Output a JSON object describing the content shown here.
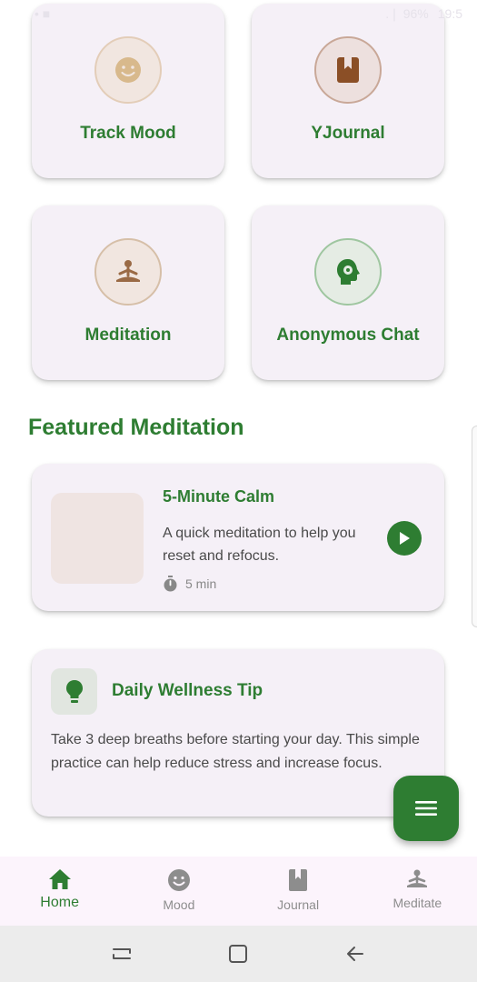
{
  "status_bar": {
    "left_text": "• ■",
    "signal": ".❘ 96%",
    "time": "19:5"
  },
  "features": [
    {
      "label": "Track Mood",
      "icon": "smiley-icon"
    },
    {
      "label": "YJournal",
      "icon": "journal-book-icon"
    },
    {
      "label": "Meditation",
      "icon": "meditation-person-icon"
    },
    {
      "label": "Anonymous Chat",
      "icon": "head-gear-icon"
    }
  ],
  "featured": {
    "section_title": "Featured Meditation",
    "title": "5-Minute Calm",
    "description": "A quick meditation to help you reset and refocus.",
    "duration": "5 min"
  },
  "tip": {
    "title": "Daily Wellness Tip",
    "body": "Take 3 deep breaths before starting your day. This simple practice can help reduce stress and increase focus."
  },
  "bottom_nav": [
    {
      "label": "Home",
      "icon": "home-icon",
      "active": true
    },
    {
      "label": "Mood",
      "icon": "smiley-icon",
      "active": false
    },
    {
      "label": "Journal",
      "icon": "journal-book-icon",
      "active": false
    },
    {
      "label": "Meditate",
      "icon": "meditation-person-icon",
      "active": false
    }
  ],
  "colors": {
    "primary": "#2e7d32",
    "card_bg": "#f5f0f7",
    "nav_bg": "#fcf4fc",
    "inactive": "#8d8d8d"
  }
}
